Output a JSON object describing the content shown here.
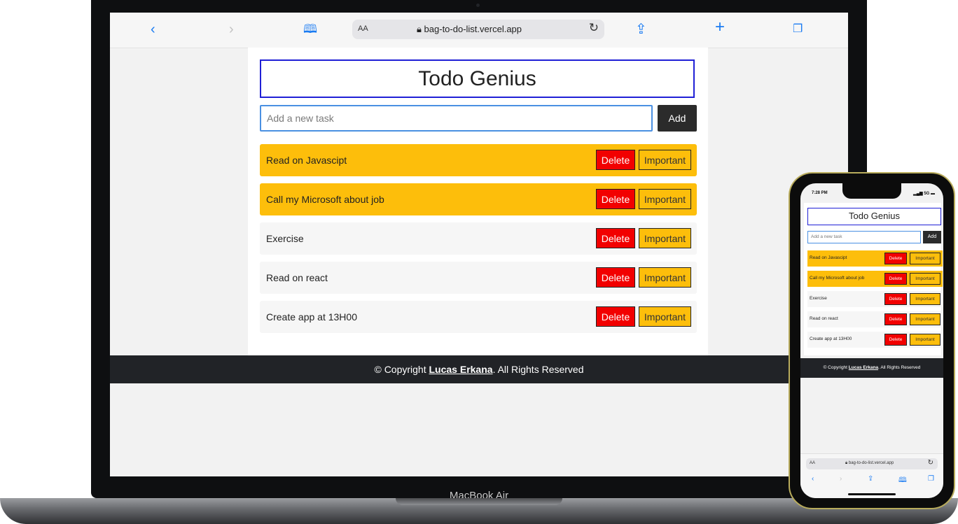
{
  "browser": {
    "url": "bag-to-do-list.vercel.app",
    "text_size_label": "AA",
    "icons": {
      "back": "chevron-left-icon",
      "forward": "chevron-right-icon",
      "bookmarks": "book-icon",
      "reload": "reload-icon",
      "share": "share-icon",
      "new_tab": "plus-icon",
      "tabs": "tabs-icon",
      "lock": "lock-icon"
    }
  },
  "app": {
    "title": "Todo Genius",
    "input_placeholder": "Add a new task",
    "add_label": "Add",
    "delete_label": "Delete",
    "important_label": "Important",
    "tasks": [
      {
        "text": "Read on Javascipt",
        "important": true
      },
      {
        "text": "Call my Microsoft about job",
        "important": true
      },
      {
        "text": "Exercise",
        "important": false
      },
      {
        "text": "Read on react",
        "important": false
      },
      {
        "text": "Create app at 13H00",
        "important": false
      }
    ],
    "footer": {
      "prefix": "© Copyright ",
      "author": "Lucas Erkana",
      "suffix": ". All Rights Reserved"
    }
  },
  "device": {
    "laptop_label": "MacBook Air",
    "phone_time": "7:28 PM",
    "phone_signal": "5G"
  },
  "colors": {
    "important_bg": "#fdbe0b",
    "delete_bg": "#f20000",
    "title_border": "#1f1fd6",
    "footer_bg": "#212327"
  }
}
